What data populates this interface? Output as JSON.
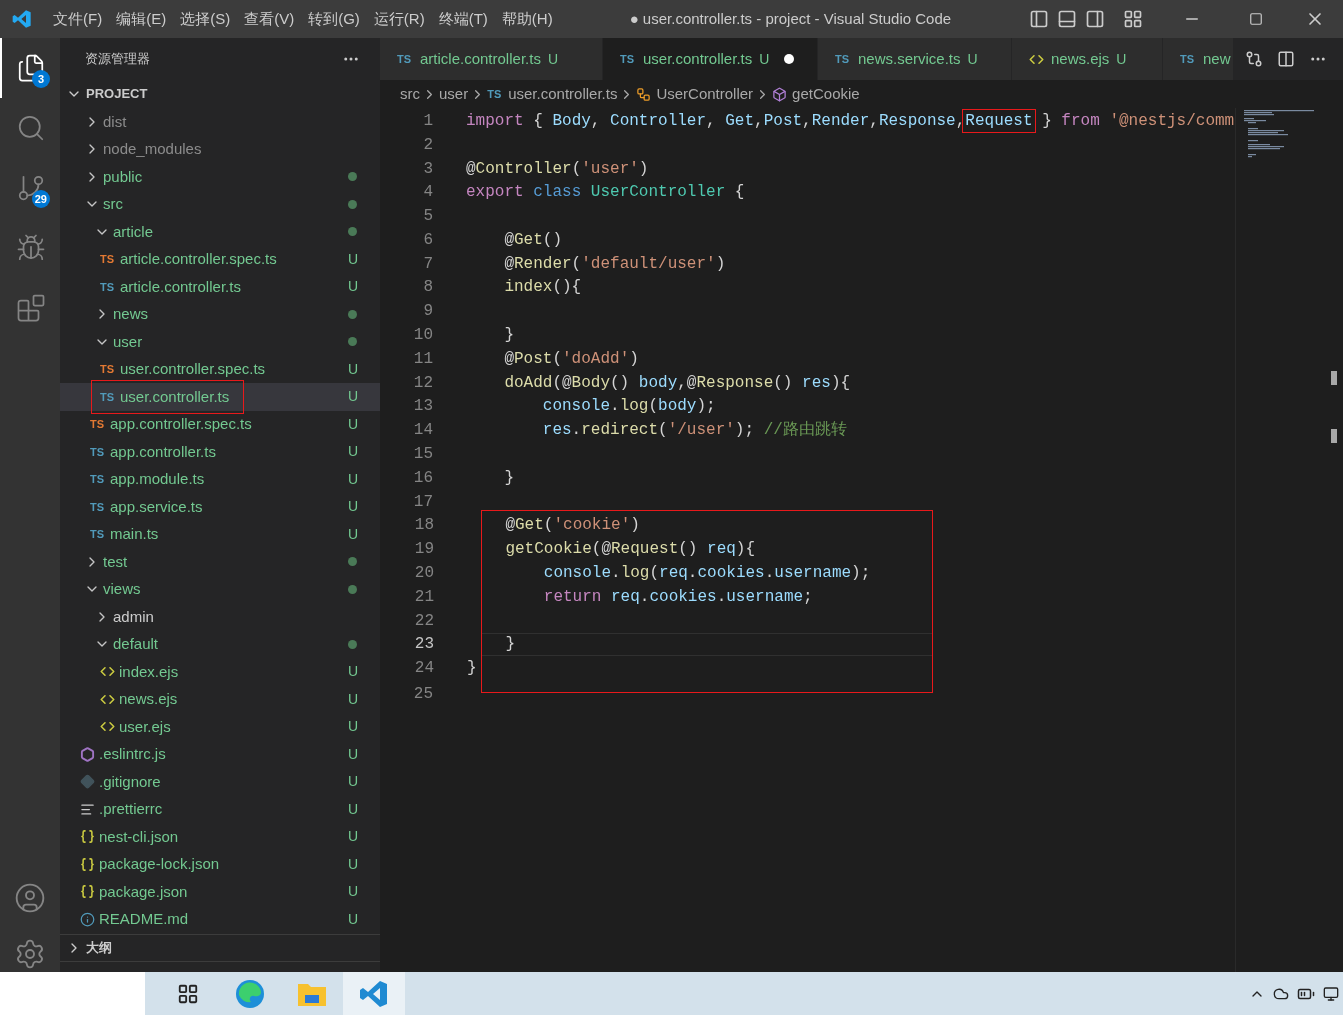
{
  "title_bar": {
    "menu": [
      "文件(F)",
      "编辑(E)",
      "选择(S)",
      "查看(V)",
      "转到(G)",
      "运行(R)",
      "终端(T)",
      "帮助(H)"
    ],
    "title": "● user.controller.ts - project - Visual Studio Code"
  },
  "activity_bar": {
    "items": [
      {
        "kind": "files",
        "selected": true,
        "badge": "3"
      },
      {
        "kind": "search",
        "selected": false
      },
      {
        "kind": "source-control",
        "selected": false,
        "badge": "29"
      },
      {
        "kind": "run",
        "selected": false
      },
      {
        "kind": "extensions",
        "selected": false
      }
    ]
  },
  "sidebar": {
    "title": "资源管理器",
    "root": "PROJECT",
    "tree": [
      {
        "label": "dist",
        "kind": "folder",
        "expanded": false,
        "ignored": true,
        "untracked": false,
        "dot": false,
        "selected": false,
        "annotated": false
      },
      {
        "label": "node_modules",
        "kind": "folder",
        "expanded": false,
        "ignored": true,
        "untracked": false,
        "dot": false,
        "selected": false,
        "annotated": false
      },
      {
        "label": "public",
        "kind": "folder",
        "expanded": false,
        "ignored": false,
        "untracked": true,
        "dot": true,
        "selected": false,
        "annotated": false
      },
      {
        "label": "src",
        "kind": "folder",
        "expanded": true,
        "ignored": false,
        "untracked": true,
        "dot": true,
        "selected": false,
        "annotated": false,
        "children": [
          {
            "label": "article",
            "kind": "folder",
            "expanded": true,
            "ignored": false,
            "untracked": true,
            "dot": true,
            "selected": false,
            "annotated": false,
            "children": [
              {
                "label": "article.controller.spec.ts",
                "kind": "ts-spec",
                "icon_text": "TS",
                "ignored": false,
                "untracked": true,
                "status": "U",
                "selected": false,
                "annotated": false
              },
              {
                "label": "article.controller.ts",
                "kind": "ts",
                "icon_text": "TS",
                "ignored": false,
                "untracked": true,
                "status": "U",
                "selected": false,
                "annotated": false
              }
            ]
          },
          {
            "label": "news",
            "kind": "folder",
            "expanded": false,
            "ignored": false,
            "untracked": true,
            "dot": true,
            "selected": false,
            "annotated": false
          },
          {
            "label": "user",
            "kind": "folder",
            "expanded": true,
            "ignored": false,
            "untracked": true,
            "dot": true,
            "selected": false,
            "annotated": false,
            "children": [
              {
                "label": "user.controller.spec.ts",
                "kind": "ts-spec",
                "icon_text": "TS",
                "ignored": false,
                "untracked": true,
                "status": "U",
                "selected": false,
                "annotated": false
              },
              {
                "label": "user.controller.ts",
                "kind": "ts",
                "icon_text": "TS",
                "ignored": false,
                "untracked": true,
                "status": "U",
                "selected": true,
                "annotated": true
              }
            ]
          },
          {
            "label": "app.controller.spec.ts",
            "kind": "ts-spec",
            "icon_text": "TS",
            "ignored": false,
            "untracked": true,
            "status": "U",
            "selected": false,
            "annotated": false
          },
          {
            "label": "app.controller.ts",
            "kind": "ts",
            "icon_text": "TS",
            "ignored": false,
            "untracked": true,
            "status": "U",
            "selected": false,
            "annotated": false
          },
          {
            "label": "app.module.ts",
            "kind": "ts",
            "icon_text": "TS",
            "ignored": false,
            "untracked": true,
            "status": "U",
            "selected": false,
            "annotated": false
          },
          {
            "label": "app.service.ts",
            "kind": "ts",
            "icon_text": "TS",
            "ignored": false,
            "untracked": true,
            "status": "U",
            "selected": false,
            "annotated": false
          },
          {
            "label": "main.ts",
            "kind": "ts",
            "icon_text": "TS",
            "ignored": false,
            "untracked": true,
            "status": "U",
            "selected": false,
            "annotated": false
          }
        ]
      },
      {
        "label": "test",
        "kind": "folder",
        "expanded": false,
        "ignored": false,
        "untracked": true,
        "dot": true,
        "selected": false,
        "annotated": false
      },
      {
        "label": "views",
        "kind": "folder",
        "expanded": true,
        "ignored": false,
        "untracked": true,
        "dot": true,
        "selected": false,
        "annotated": false,
        "children": [
          {
            "label": "admin",
            "kind": "folder",
            "expanded": false,
            "ignored": false,
            "untracked": false,
            "dot": false,
            "selected": false,
            "annotated": false
          },
          {
            "label": "default",
            "kind": "folder",
            "expanded": true,
            "ignored": false,
            "untracked": true,
            "dot": true,
            "selected": false,
            "annotated": false,
            "children": [
              {
                "label": "index.ejs",
                "kind": "ejs",
                "ignored": false,
                "untracked": true,
                "status": "U",
                "selected": false,
                "annotated": false
              },
              {
                "label": "news.ejs",
                "kind": "ejs",
                "ignored": false,
                "untracked": true,
                "status": "U",
                "selected": false,
                "annotated": false
              },
              {
                "label": "user.ejs",
                "kind": "ejs",
                "ignored": false,
                "untracked": true,
                "status": "U",
                "selected": false,
                "annotated": false
              }
            ]
          }
        ]
      },
      {
        "label": ".eslintrc.js",
        "kind": "eslint",
        "ignored": false,
        "untracked": true,
        "status": "U",
        "selected": false,
        "annotated": false
      },
      {
        "label": ".gitignore",
        "kind": "git",
        "ignored": false,
        "untracked": true,
        "status": "U",
        "selected": false,
        "annotated": false
      },
      {
        "label": ".prettierrc",
        "kind": "prettier",
        "ignored": false,
        "untracked": true,
        "status": "U",
        "selected": false,
        "annotated": false
      },
      {
        "label": "nest-cli.json",
        "kind": "json",
        "ignored": false,
        "untracked": true,
        "status": "U",
        "selected": false,
        "annotated": false
      },
      {
        "label": "package-lock.json",
        "kind": "json",
        "ignored": false,
        "untracked": true,
        "status": "U",
        "selected": false,
        "annotated": false
      },
      {
        "label": "package.json",
        "kind": "json",
        "ignored": false,
        "untracked": true,
        "status": "U",
        "selected": false,
        "annotated": false
      },
      {
        "label": "README.md",
        "kind": "info",
        "ignored": false,
        "untracked": true,
        "status": "U",
        "selected": false,
        "annotated": false
      }
    ],
    "outline": "大纲"
  },
  "tabs": [
    {
      "label": "article.controller.ts",
      "kind": "ts",
      "icon_text": "TS",
      "badge": "U",
      "selected": false,
      "dirty": false
    },
    {
      "label": "user.controller.ts",
      "kind": "ts",
      "icon_text": "TS",
      "badge": "U",
      "selected": true,
      "dirty": true
    },
    {
      "label": "news.service.ts",
      "kind": "ts",
      "icon_text": "TS",
      "badge": "U",
      "selected": false,
      "dirty": false
    },
    {
      "label": "news.ejs",
      "kind": "ejs",
      "badge": "U",
      "selected": false,
      "dirty": false
    },
    {
      "label": "new",
      "kind": "ts",
      "icon_text": "TS",
      "selected": false,
      "dirty": false
    }
  ],
  "breadcrumbs": [
    {
      "label": "src",
      "kind": "folder"
    },
    {
      "label": "user",
      "kind": "folder"
    },
    {
      "label": "user.controller.ts",
      "kind": "ts",
      "icon_text": "TS"
    },
    {
      "label": "UserController",
      "kind": "class"
    },
    {
      "label": "getCookie",
      "kind": "method"
    }
  ],
  "code": {
    "sections": [
      {
        "boxed": false,
        "lines": [
          {
            "number": "1",
            "current": false,
            "kind": "top",
            "tokens": [
              {
                "kind": "kw",
                "text": "import"
              },
              {
                "kind": "p",
                "text": " { "
              },
              {
                "kind": "var",
                "text": "Body"
              },
              {
                "kind": "p",
                "text": ", "
              },
              {
                "kind": "var",
                "text": "Controller"
              },
              {
                "kind": "p",
                "text": ", "
              },
              {
                "kind": "var",
                "text": "Get"
              },
              {
                "kind": "p",
                "text": ","
              },
              {
                "kind": "var",
                "text": "Post"
              },
              {
                "kind": "p",
                "text": ","
              },
              {
                "kind": "var",
                "text": "Render"
              },
              {
                "kind": "p",
                "text": ","
              },
              {
                "kind": "var",
                "text": "Response"
              },
              {
                "kind": "p",
                "text": ","
              },
              {
                "kind": "var",
                "text": "Request",
                "boxed": true
              },
              {
                "kind": "p",
                "text": " } "
              },
              {
                "kind": "kw",
                "text": "from "
              },
              {
                "kind": "str",
                "text": "'@nestjs/comm"
              }
            ]
          },
          {
            "number": "2",
            "current": false
          },
          {
            "number": "3",
            "current": false,
            "kind": "top",
            "tokens": [
              {
                "kind": "p",
                "text": "@"
              },
              {
                "kind": "fn",
                "text": "Controller"
              },
              {
                "kind": "p",
                "text": "("
              },
              {
                "kind": "str",
                "text": "'user'"
              },
              {
                "kind": "p",
                "text": ")"
              }
            ]
          },
          {
            "number": "4",
            "current": false,
            "kind": "top",
            "tokens": [
              {
                "kind": "kw",
                "text": "export "
              },
              {
                "kind": "kw2",
                "text": "class "
              },
              {
                "kind": "cls",
                "text": "UserController"
              },
              {
                "kind": "p",
                "text": " {"
              }
            ]
          },
          {
            "number": "5",
            "current": false
          },
          {
            "number": "6",
            "current": false,
            "kind": "member",
            "tokens": [
              {
                "kind": "p",
                "text": "@"
              },
              {
                "kind": "fn",
                "text": "Get"
              },
              {
                "kind": "p",
                "text": "()"
              }
            ]
          },
          {
            "number": "7",
            "current": false,
            "kind": "member",
            "tokens": [
              {
                "kind": "p",
                "text": "@"
              },
              {
                "kind": "fn",
                "text": "Render"
              },
              {
                "kind": "p",
                "text": "("
              },
              {
                "kind": "str",
                "text": "'default/user'"
              },
              {
                "kind": "p",
                "text": ")"
              }
            ]
          },
          {
            "number": "8",
            "current": false,
            "kind": "member",
            "tokens": [
              {
                "kind": "fn",
                "text": "index"
              },
              {
                "kind": "p",
                "text": "(){"
              }
            ]
          },
          {
            "number": "9",
            "current": false
          },
          {
            "number": "10",
            "current": false,
            "kind": "member",
            "tokens": [
              {
                "kind": "p",
                "text": "}"
              }
            ]
          },
          {
            "number": "11",
            "current": false,
            "kind": "member",
            "tokens": [
              {
                "kind": "p",
                "text": "@"
              },
              {
                "kind": "fn",
                "text": "Post"
              },
              {
                "kind": "p",
                "text": "("
              },
              {
                "kind": "str",
                "text": "'doAdd'"
              },
              {
                "kind": "p",
                "text": ")"
              }
            ]
          },
          {
            "number": "12",
            "current": false,
            "kind": "member",
            "tokens": [
              {
                "kind": "fn",
                "text": "doAdd"
              },
              {
                "kind": "p",
                "text": "(@"
              },
              {
                "kind": "fn",
                "text": "Body"
              },
              {
                "kind": "p",
                "text": "() "
              },
              {
                "kind": "var",
                "text": "body"
              },
              {
                "kind": "p",
                "text": ",@"
              },
              {
                "kind": "fn",
                "text": "Response"
              },
              {
                "kind": "p",
                "text": "() "
              },
              {
                "kind": "var",
                "text": "res"
              },
              {
                "kind": "p",
                "text": "){"
              }
            ]
          },
          {
            "number": "13",
            "current": false,
            "kind": "body",
            "tokens": [
              {
                "kind": "var",
                "text": "console"
              },
              {
                "kind": "p",
                "text": "."
              },
              {
                "kind": "fn",
                "text": "log"
              },
              {
                "kind": "p",
                "text": "("
              },
              {
                "kind": "var",
                "text": "body"
              },
              {
                "kind": "p",
                "text": ");"
              }
            ]
          },
          {
            "number": "14",
            "current": false,
            "kind": "body",
            "tokens": [
              {
                "kind": "var",
                "text": "res"
              },
              {
                "kind": "p",
                "text": "."
              },
              {
                "kind": "fn",
                "text": "redirect"
              },
              {
                "kind": "p",
                "text": "("
              },
              {
                "kind": "str",
                "text": "'/user'"
              },
              {
                "kind": "p",
                "text": "); "
              },
              {
                "kind": "cm",
                "text": "//路由跳转"
              }
            ]
          },
          {
            "number": "15",
            "current": false
          },
          {
            "number": "16",
            "current": false,
            "kind": "member",
            "tokens": [
              {
                "kind": "p",
                "text": "}"
              }
            ]
          },
          {
            "number": "17",
            "current": false
          }
        ]
      },
      {
        "boxed": true,
        "lines": [
          {
            "number": "18",
            "current": false,
            "kind": "member",
            "tokens": [
              {
                "kind": "p",
                "text": "@"
              },
              {
                "kind": "fn",
                "text": "Get"
              },
              {
                "kind": "p",
                "text": "("
              },
              {
                "kind": "str",
                "text": "'cookie'"
              },
              {
                "kind": "p",
                "text": ")"
              }
            ]
          },
          {
            "number": "19",
            "current": false,
            "kind": "member",
            "tokens": [
              {
                "kind": "fn",
                "text": "getCookie"
              },
              {
                "kind": "p",
                "text": "(@"
              },
              {
                "kind": "fn",
                "text": "Request"
              },
              {
                "kind": "p",
                "text": "() "
              },
              {
                "kind": "var",
                "text": "req"
              },
              {
                "kind": "p",
                "text": "){"
              }
            ]
          },
          {
            "number": "20",
            "current": false,
            "kind": "body",
            "tokens": [
              {
                "kind": "var",
                "text": "console"
              },
              {
                "kind": "p",
                "text": "."
              },
              {
                "kind": "fn",
                "text": "log"
              },
              {
                "kind": "p",
                "text": "("
              },
              {
                "kind": "var",
                "text": "req"
              },
              {
                "kind": "p",
                "text": "."
              },
              {
                "kind": "var",
                "text": "cookies"
              },
              {
                "kind": "p",
                "text": "."
              },
              {
                "kind": "var",
                "text": "username"
              },
              {
                "kind": "p",
                "text": ");"
              }
            ]
          },
          {
            "number": "21",
            "current": false,
            "kind": "body",
            "tokens": [
              {
                "kind": "kw",
                "text": "return "
              },
              {
                "kind": "var",
                "text": "req"
              },
              {
                "kind": "p",
                "text": "."
              },
              {
                "kind": "var",
                "text": "cookies"
              },
              {
                "kind": "p",
                "text": "."
              },
              {
                "kind": "var",
                "text": "username"
              },
              {
                "kind": "p",
                "text": ";"
              }
            ]
          },
          {
            "number": "22",
            "current": false
          },
          {
            "number": "23",
            "current": true,
            "kind": "member",
            "tokens": [
              {
                "kind": "p",
                "text": "}"
              }
            ]
          },
          {
            "number": "24",
            "current": false,
            "kind": "top",
            "tokens": [
              {
                "kind": "p",
                "text": "}"
              }
            ]
          }
        ]
      },
      {
        "boxed": false,
        "lines": [
          {
            "number": "25",
            "current": false
          }
        ]
      }
    ]
  },
  "taskbar": {
    "apps": [
      {
        "kind": "task-view",
        "selected": false
      },
      {
        "kind": "edge",
        "selected": false
      },
      {
        "kind": "explorer",
        "selected": false
      },
      {
        "kind": "vscode",
        "selected": true
      }
    ]
  }
}
